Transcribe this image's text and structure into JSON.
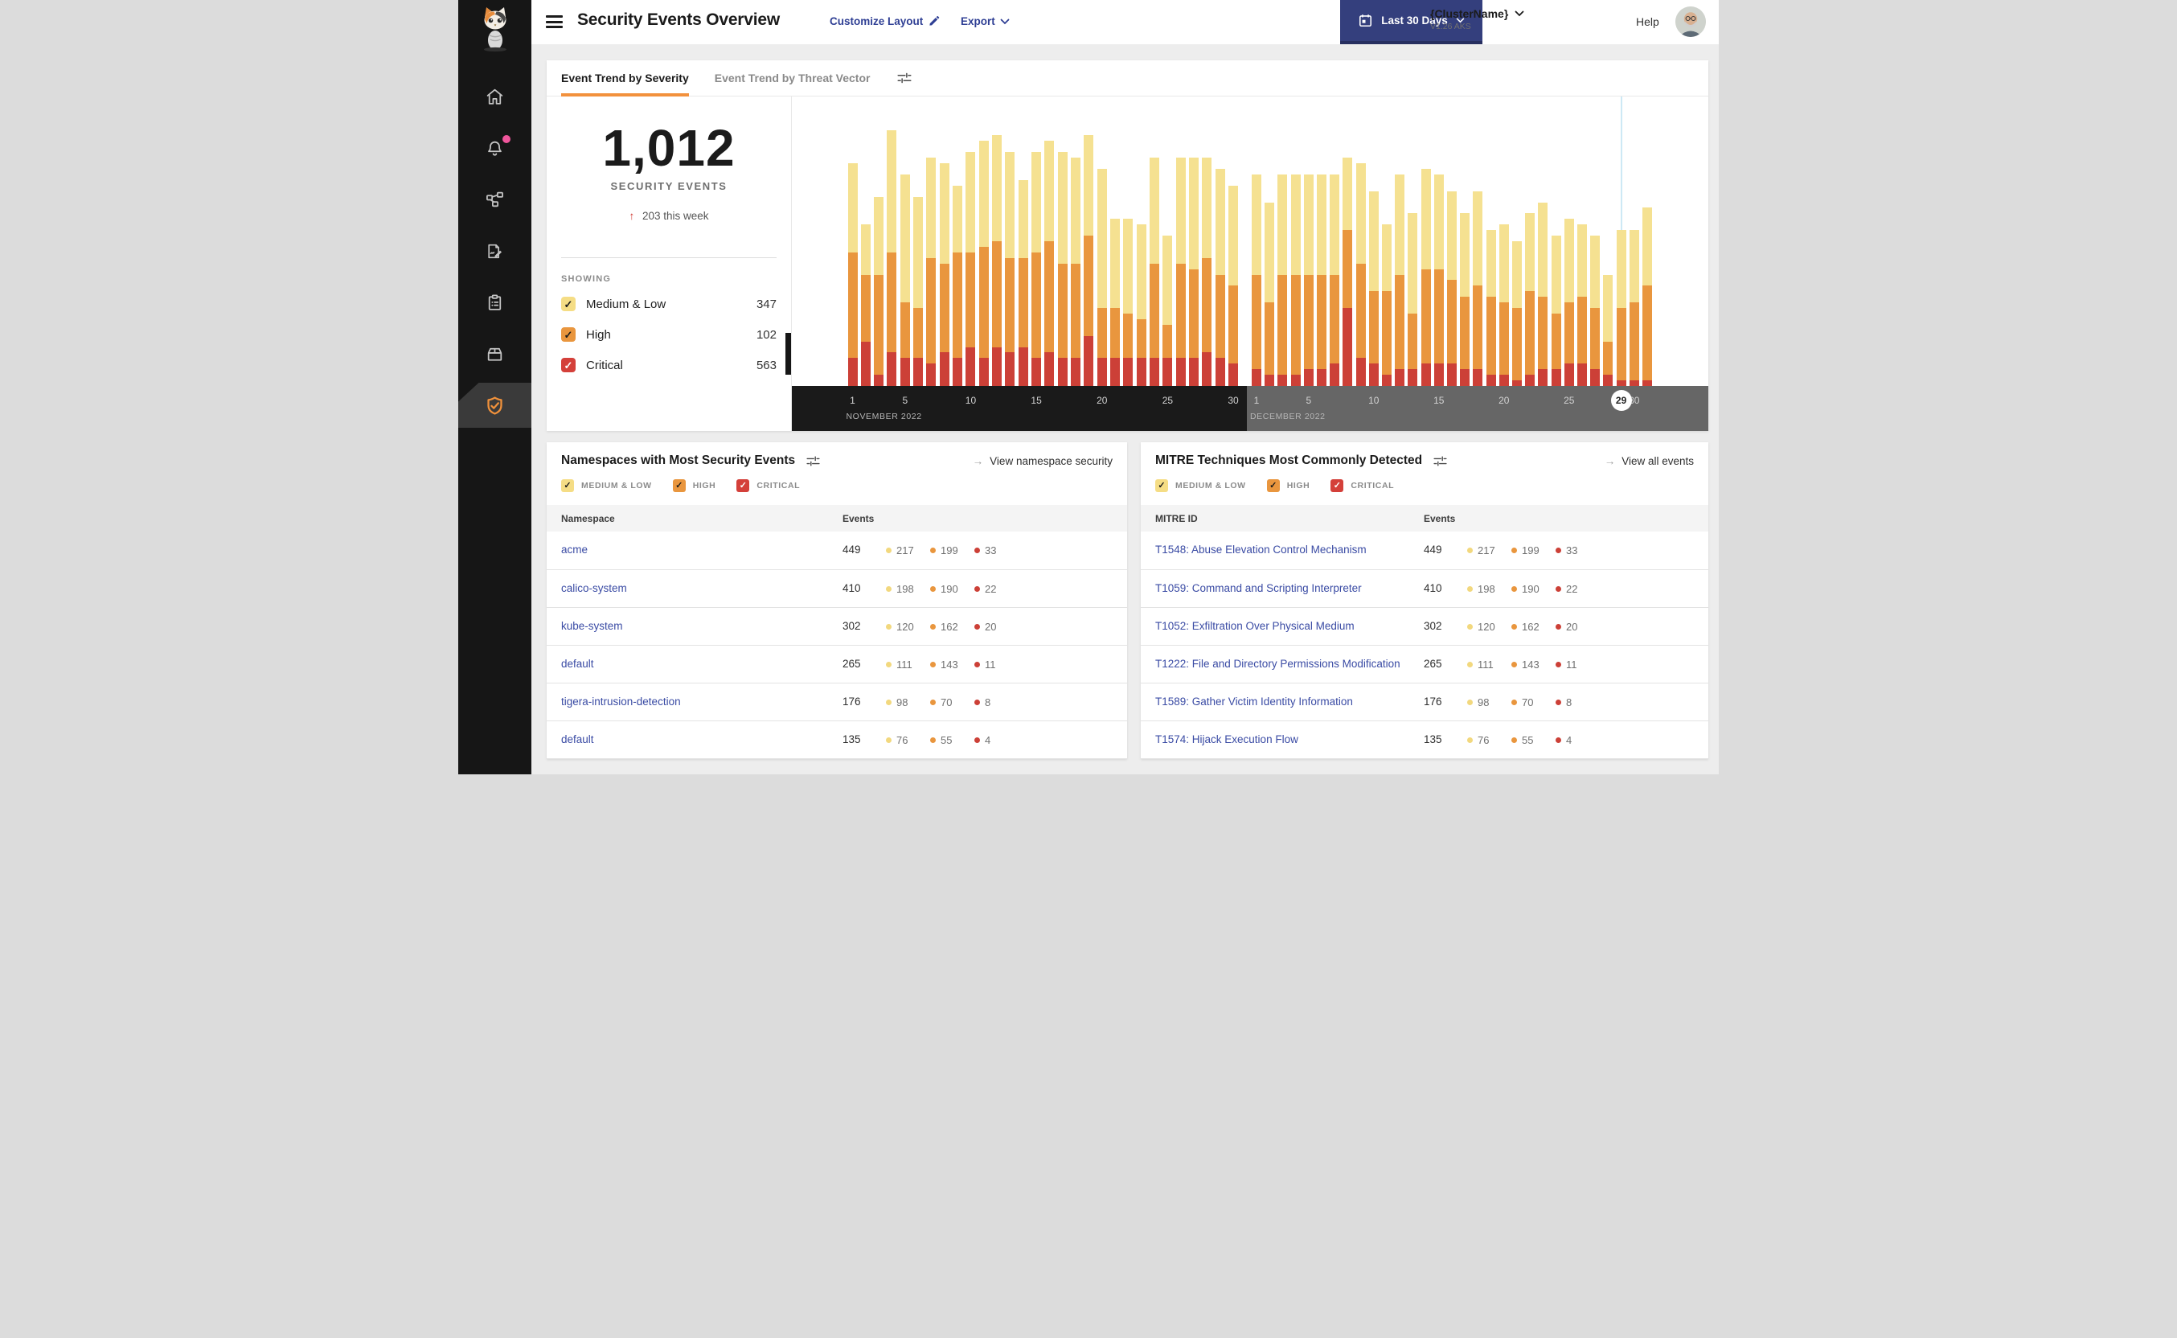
{
  "colors": {
    "page_bg": "#EDEDED",
    "sidebar_bg": "#161616",
    "sidebar_active_bg": "#3A3A3A",
    "accent_orange": "#F2913D",
    "navy_button": "#343F7D",
    "link_navy": "#2F3F94",
    "table_link": "#3A4BA4",
    "notification_pink": "#F0569C",
    "severity_medium_low": "#F5E191",
    "severity_high": "#E9963E",
    "severity_critical": "#CC4037",
    "axis_november_bg": "#1A1A1A",
    "axis_december_bg": "#666666",
    "today_line": "#CDE9F5"
  },
  "sidebar": {
    "items": [
      {
        "name": "home"
      },
      {
        "name": "alerts",
        "badge": true
      },
      {
        "name": "service-graph"
      },
      {
        "name": "logs"
      },
      {
        "name": "compliance"
      },
      {
        "name": "workloads"
      },
      {
        "name": "threat-defense",
        "active": true
      }
    ],
    "icons": [
      "home-icon",
      "bell-icon",
      "service-graph-icon",
      "edit-log-icon",
      "clipboard-icon",
      "box-icon",
      "shield-check-icon"
    ]
  },
  "header": {
    "title": "Security Events Overview",
    "customize_label": "Customize Layout",
    "export_label": "Export",
    "date_range_label": "Last 30 Days",
    "cluster_name": "{ClusterName}",
    "cluster_version": "V1.26 AKS",
    "help_label": "Help",
    "icons": [
      "hamburger-icon",
      "pencil-icon",
      "chevron-down-icon",
      "calendar-icon",
      "avatar"
    ]
  },
  "trend": {
    "tabs": [
      {
        "label": "Event Trend by Severity",
        "active": true
      },
      {
        "label": "Event Trend by Threat Vector",
        "active": false
      }
    ],
    "total": "1,012",
    "total_label": "SECURITY EVENTS",
    "delta_arrow": "↑",
    "delta_text": "203 this week",
    "showing_label": "SHOWING",
    "legend": [
      {
        "label": "Medium & Low",
        "value": "347",
        "color": "#F5DD85",
        "check_color": "#1b1b1b"
      },
      {
        "label": "High",
        "value": "102",
        "color": "#E9963E",
        "check_color": "#1b1b1b"
      },
      {
        "label": "Critical",
        "value": "563",
        "color": "#D4403A",
        "check_color": "#ffffff"
      }
    ]
  },
  "chart_data": {
    "type": "bar",
    "stacked": true,
    "units": "security events per day (estimated from bar heights, no y-axis shown)",
    "ylim": [
      0,
      52
    ],
    "grid": false,
    "legend_position": "left-panel",
    "months": [
      {
        "label": "NOVEMBER 2022",
        "days": 30,
        "ticks": [
          1,
          5,
          10,
          15,
          20,
          25,
          30
        ]
      },
      {
        "label": "DECEMBER 2022",
        "days": 31,
        "ticks": [
          1,
          5,
          10,
          15,
          20,
          25,
          30
        ]
      }
    ],
    "marker": {
      "month_index": 1,
      "day": 29
    },
    "today_line": {
      "month_index": 1,
      "day": 29
    },
    "series": [
      {
        "name": "Critical",
        "color": "#CC4037",
        "values": [
          5,
          8,
          2,
          6,
          5,
          5,
          4,
          6,
          5,
          7,
          5,
          7,
          6,
          7,
          5,
          6,
          5,
          5,
          9,
          5,
          5,
          5,
          5,
          5,
          5,
          5,
          5,
          6,
          5,
          4,
          3,
          2,
          2,
          2,
          3,
          3,
          4,
          14,
          5,
          4,
          2,
          3,
          3,
          4,
          4,
          4,
          3,
          3,
          2,
          2,
          1,
          2,
          3,
          3,
          4,
          4,
          3,
          2,
          1,
          1,
          1
        ]
      },
      {
        "name": "High",
        "color": "#E9963E",
        "values": [
          19,
          12,
          18,
          18,
          10,
          9,
          19,
          16,
          19,
          17,
          20,
          19,
          17,
          16,
          19,
          20,
          17,
          17,
          18,
          9,
          9,
          8,
          7,
          17,
          6,
          17,
          16,
          17,
          15,
          14,
          17,
          13,
          18,
          18,
          17,
          17,
          16,
          14,
          17,
          13,
          15,
          17,
          10,
          17,
          17,
          15,
          13,
          15,
          14,
          13,
          13,
          15,
          13,
          10,
          11,
          12,
          11,
          6,
          13,
          14,
          17
        ]
      },
      {
        "name": "Medium & Low",
        "color": "#F5E191",
        "values": [
          16,
          9,
          14,
          22,
          23,
          20,
          18,
          18,
          12,
          18,
          19,
          19,
          19,
          14,
          18,
          18,
          20,
          19,
          18,
          25,
          16,
          17,
          17,
          19,
          16,
          19,
          20,
          18,
          19,
          18,
          18,
          18,
          18,
          18,
          18,
          18,
          18,
          13,
          18,
          18,
          12,
          18,
          18,
          18,
          17,
          16,
          15,
          17,
          12,
          14,
          12,
          14,
          17,
          14,
          15,
          13,
          13,
          12,
          14,
          13,
          14
        ]
      }
    ]
  },
  "filters": [
    {
      "label": "MEDIUM & LOW",
      "color": "#F5DD85",
      "check_color": "#1b1b1b"
    },
    {
      "label": "HIGH",
      "color": "#E9963E",
      "check_color": "#1b1b1b"
    },
    {
      "label": "CRITICAL",
      "color": "#D4403A",
      "check_color": "#ffffff"
    }
  ],
  "namespaces": {
    "title": "Namespaces with Most Security Events",
    "link_arrow": "→",
    "link_label": "View namespace security",
    "columns": [
      "Namespace",
      "Events"
    ],
    "rows": [
      {
        "name": "acme",
        "events": "449",
        "medium_low": "217",
        "high": "199",
        "critical": "33"
      },
      {
        "name": "calico-system",
        "events": "410",
        "medium_low": "198",
        "high": "190",
        "critical": "22"
      },
      {
        "name": "kube-system",
        "events": "302",
        "medium_low": "120",
        "high": "162",
        "critical": "20"
      },
      {
        "name": "default",
        "events": "265",
        "medium_low": "111",
        "high": "143",
        "critical": "11"
      },
      {
        "name": "tigera-intrusion-detection",
        "events": "176",
        "medium_low": "98",
        "high": "70",
        "critical": "8"
      },
      {
        "name": "default",
        "events": "135",
        "medium_low": "76",
        "high": "55",
        "critical": "4"
      }
    ]
  },
  "mitre": {
    "title": "MITRE Techniques Most Commonly Detected",
    "link_arrow": "→",
    "link_label": "View all events",
    "columns": [
      "MITRE ID",
      "Events"
    ],
    "rows": [
      {
        "name": "T1548: Abuse Elevation Control Mechanism",
        "events": "449",
        "medium_low": "217",
        "high": "199",
        "critical": "33"
      },
      {
        "name": "T1059: Command and Scripting Interpreter",
        "events": "410",
        "medium_low": "198",
        "high": "190",
        "critical": "22"
      },
      {
        "name": "T1052: Exfiltration Over Physical Medium",
        "events": "302",
        "medium_low": "120",
        "high": "162",
        "critical": "20"
      },
      {
        "name": "T1222: File and Directory Permissions Modification",
        "events": "265",
        "medium_low": "111",
        "high": "143",
        "critical": "11"
      },
      {
        "name": "T1589: Gather Victim Identity Information",
        "events": "176",
        "medium_low": "98",
        "high": "70",
        "critical": "8"
      },
      {
        "name": "T1574: Hijack Execution Flow",
        "events": "135",
        "medium_low": "76",
        "high": "55",
        "critical": "4"
      }
    ]
  }
}
